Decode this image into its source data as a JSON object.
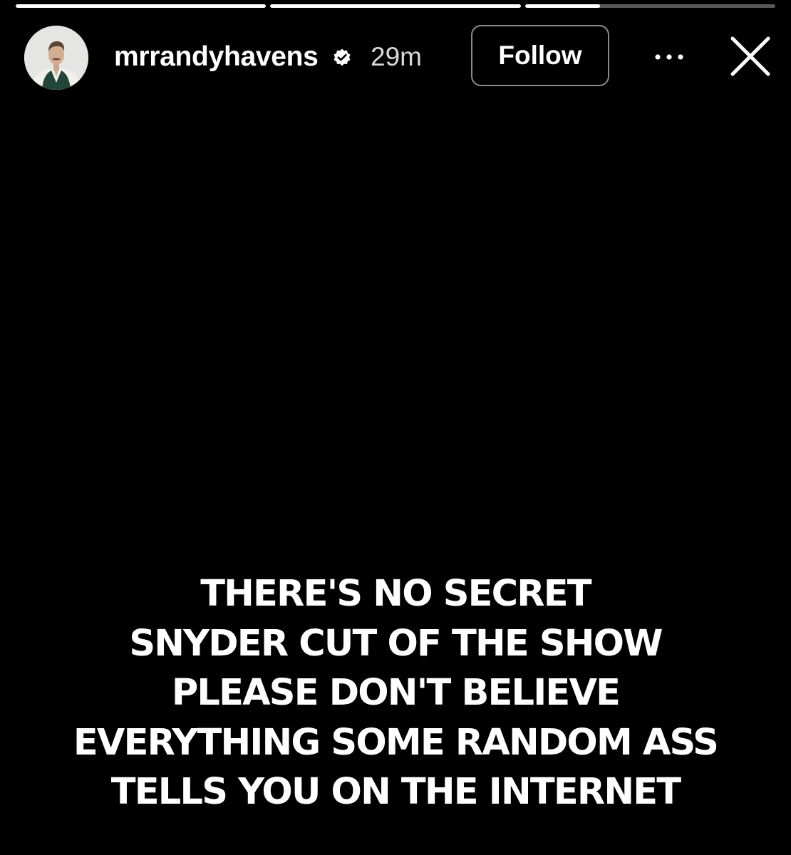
{
  "story": {
    "segments": [
      {
        "progress": 1.0
      },
      {
        "progress": 1.0
      },
      {
        "progress": 0.3
      }
    ]
  },
  "header": {
    "username": "mrrandyhavens",
    "verified_icon": "verified-badge-icon",
    "time": "29m",
    "follow_label": "Follow",
    "more_icon": "more-dots-icon",
    "close_icon": "close-icon"
  },
  "caption": {
    "lines": [
      "THERE'S NO SECRET",
      "SNYDER CUT OF THE SHOW",
      "PLEASE DON'T BELIEVE",
      "EVERYTHING SOME RANDOM ASS",
      "TELLS YOU ON THE INTERNET"
    ]
  },
  "colors": {
    "background": "#000000",
    "text": "#ffffff",
    "button_border": "#8a8a8a"
  }
}
